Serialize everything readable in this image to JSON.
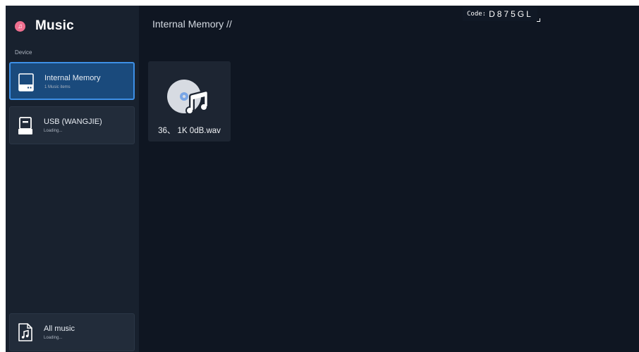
{
  "app": {
    "title": "Music",
    "logo_icon": "music-note-icon",
    "accent_color": "#ef6f8f"
  },
  "sidebar": {
    "section_label": "Device",
    "devices": [
      {
        "name": "Internal Memory",
        "status": "1 Music items",
        "icon": "internal-storage-icon",
        "selected": true
      },
      {
        "name": "USB (WANGJIE)",
        "status": "Loading...",
        "icon": "usb-drive-icon",
        "selected": false
      }
    ],
    "all_music": {
      "name": "All music",
      "status": "Loading...",
      "icon": "music-file-icon"
    }
  },
  "breadcrumb": "Internal Memory //",
  "code_badge": {
    "label": "Code:",
    "value": "D875GL"
  },
  "files": [
    {
      "name": "36、 1K 0dB.wav",
      "icon": "music-disc-icon"
    }
  ],
  "colors": {
    "background": "#0f1622",
    "sidebar": "#18212e",
    "selection": "#1a4a7c",
    "selection_border": "#3d8fe6",
    "disc": "#d7dbe2",
    "disc_center": "#7aa6e6"
  }
}
